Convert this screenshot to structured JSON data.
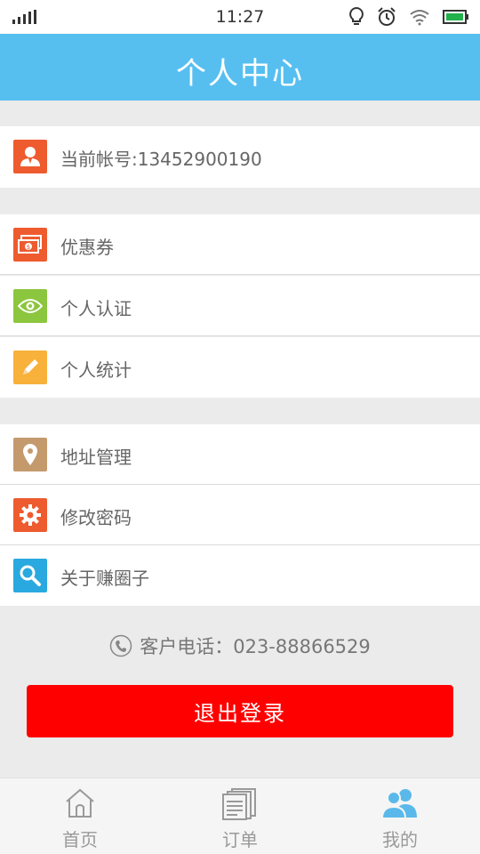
{
  "status_bar": {
    "time": "11:27"
  },
  "header": {
    "title": "个人中心"
  },
  "account": {
    "label": "当前帐号:13452900190"
  },
  "menu": {
    "coupon": "优惠券",
    "verify": "个人认证",
    "stats": "个人统计",
    "address": "地址管理",
    "password": "修改密码",
    "about": "关于赚圈子"
  },
  "contact": {
    "phone_text": "客户电话：023-88866529"
  },
  "logout_label": "退出登录",
  "tabs": {
    "home": "首页",
    "orders": "订单",
    "mine": "我的"
  },
  "colors": {
    "header": "#57bff0",
    "logout": "#ff0000",
    "account_icon": "#ee5b2f",
    "coupon_icon": "#ee5b2f",
    "verify_icon": "#8cc63f",
    "stats_icon": "#f8b13a",
    "address_icon": "#c49a6c",
    "password_icon": "#ee5b2f",
    "about_icon": "#29a9df",
    "active_tab": "#5ab9ea"
  },
  "icons": {
    "account": "user-icon",
    "coupon": "money-icon",
    "verify": "eye-icon",
    "stats": "pencil-icon",
    "address": "location-pin-icon",
    "password": "gear-icon",
    "about": "magnifier-icon",
    "home_tab": "house-icon",
    "orders_tab": "document-icon",
    "mine_tab": "users-icon"
  }
}
